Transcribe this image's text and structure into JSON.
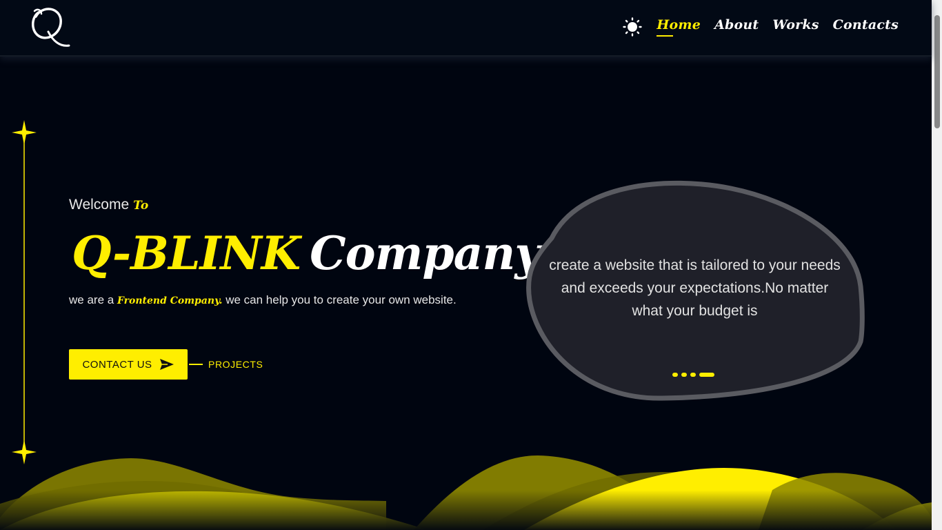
{
  "header": {
    "logo_letter": "Q",
    "nav": [
      {
        "label": "Home",
        "active": true
      },
      {
        "label": "About",
        "active": false
      },
      {
        "label": "Works",
        "active": false
      },
      {
        "label": "Contacts",
        "active": false
      }
    ],
    "theme_icon": "sun-icon"
  },
  "hero": {
    "welcome": "Welcome",
    "welcome_to": "To",
    "brand": "Q-BLINK",
    "title_rest": "Company",
    "tagline_before": "we are a ",
    "tagline_highlight": "Frontend Company.",
    "tagline_after": " we can help you to create your own website.",
    "contact_label": "CONTACT US",
    "contact_icon": "send-icon",
    "projects_label": "PROJECTS"
  },
  "card": {
    "text": "create a website that is tailored to your needs and exceeds your expectations.No matter what your budget is",
    "slides": 4,
    "active_slide": 4
  },
  "colors": {
    "accent": "#ffee00",
    "background": "#000510",
    "card": "#1f2029",
    "card_border": "#5a5b61"
  }
}
